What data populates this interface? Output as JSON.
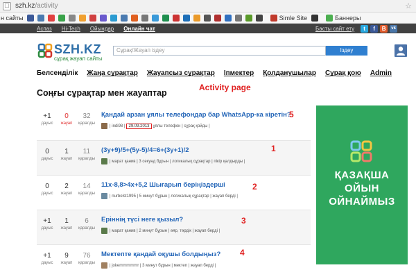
{
  "browser": {
    "url_host": "szh.kz",
    "url_path": "/activity"
  },
  "bookmarks": {
    "first": "н сайты",
    "items": [
      {
        "label": "Simle Site"
      },
      {
        "label": "Баннеры"
      }
    ]
  },
  "topnav": {
    "items": [
      "Аспаз",
      "Hi-Tech",
      "Ойындар",
      "Онлайн чат"
    ],
    "follow_label": "Басты сайт ету",
    "social": [
      "t",
      "f",
      "B",
      "vk"
    ]
  },
  "header": {
    "logo_name": "SZH.KZ",
    "logo_tagline": "сұрақ жауап сайты",
    "search_placeholder": "Сұрақ/Жауап іздеу",
    "search_button": "Іздеу"
  },
  "mainnav": [
    "Белсенділік",
    "Жаңа сұрақтар",
    "Жауапсыз сұрақтар",
    "Іпмектер",
    "Қолданушылар",
    "Сұрақ қою",
    "Admin"
  ],
  "page_title": "Соңғы сұрақтар мен жауаптар",
  "annotations": {
    "title": "Activity page"
  },
  "questions": [
    {
      "votes": "+1",
      "votes_label": "дауыс",
      "answers": "0",
      "answers_label": "жауап",
      "views": "32",
      "views_label": "қаралды",
      "title": "Қандай арзан ұялы телефондар бар WhatsApp-ка кіретін?",
      "user": "indi98",
      "date": "29.09.2013",
      "meta_rest": "ұялы телефон | сұрақ қойды |",
      "annotation": "5"
    },
    {
      "votes": "0",
      "votes_label": "дауыс",
      "answers": "1",
      "answers_label": "жауап",
      "views": "11",
      "views_label": "қаралды",
      "title": "(3у+9)/5+(5у-5)/4=6+(3у+1)/2",
      "meta_rest": "| марат қанив | 3 секунд бұрын | логикалық сұрақтар | пікір қалдырды |",
      "annotation": "1"
    },
    {
      "votes": "0",
      "votes_label": "дауыс",
      "answers": "2",
      "answers_label": "жауап",
      "views": "14",
      "views_label": "қаралды",
      "title": "11x-8,8>4x+5,2 Шығарып беріңіздерші",
      "meta_rest": "| nurbolst1995 | 5 минут бұрын | логикалық сұрақтар | жауап берді |",
      "annotation": "2"
    },
    {
      "votes": "+1",
      "votes_label": "дауыс",
      "answers": "1",
      "answers_label": "жауап",
      "views": "6",
      "views_label": "қаралды",
      "title": "Еріннің түсі неге қызыл?",
      "meta_rest": "| марат қанив | 2 минут бұрын | әяр, тәрдік | жауап берді |",
      "annotation": "3"
    },
    {
      "votes": "+1",
      "votes_label": "дауыс",
      "answers": "9",
      "answers_label": "жауап",
      "views": "76",
      "views_label": "қаралды",
      "title": "Мектепте қандай оқушы болдыңыз?",
      "meta_rest": "| jokerrrrrrrrrrrrrr | 3 минут бұрын | мектеп | жауап берді |",
      "annotation": "4"
    }
  ],
  "ad": {
    "line1": "ҚАЗАҚША",
    "line2": "ОЙЫН",
    "line3": "ОЙНАЙМЫЗ"
  },
  "colors": {
    "link": "#2466b8",
    "annotation": "#e02020",
    "ad_bg": "#2fa75e",
    "topstrip": "#414141"
  }
}
